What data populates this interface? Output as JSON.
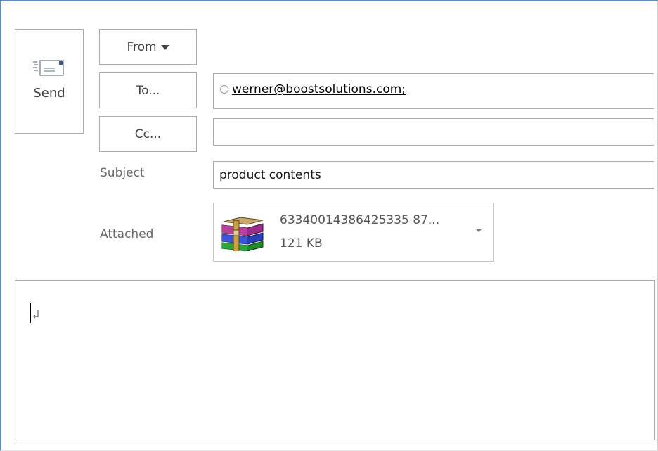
{
  "toolbar": {
    "send_label": "Send",
    "from_label": "From",
    "to_label": "To...",
    "cc_label": "Cc..."
  },
  "fields": {
    "to_value": "werner@boostsolutions.com;",
    "cc_value": "",
    "subject_label": "Subject",
    "subject_value": "product contents",
    "attached_label": "Attached"
  },
  "attachment": {
    "name": "63340014386425335 87...",
    "size": "121 KB",
    "icon": "winrar-archive-icon"
  },
  "body": {
    "text": ""
  },
  "colors": {
    "accent_border": "#5b8fb9",
    "button_border": "#ababab"
  }
}
